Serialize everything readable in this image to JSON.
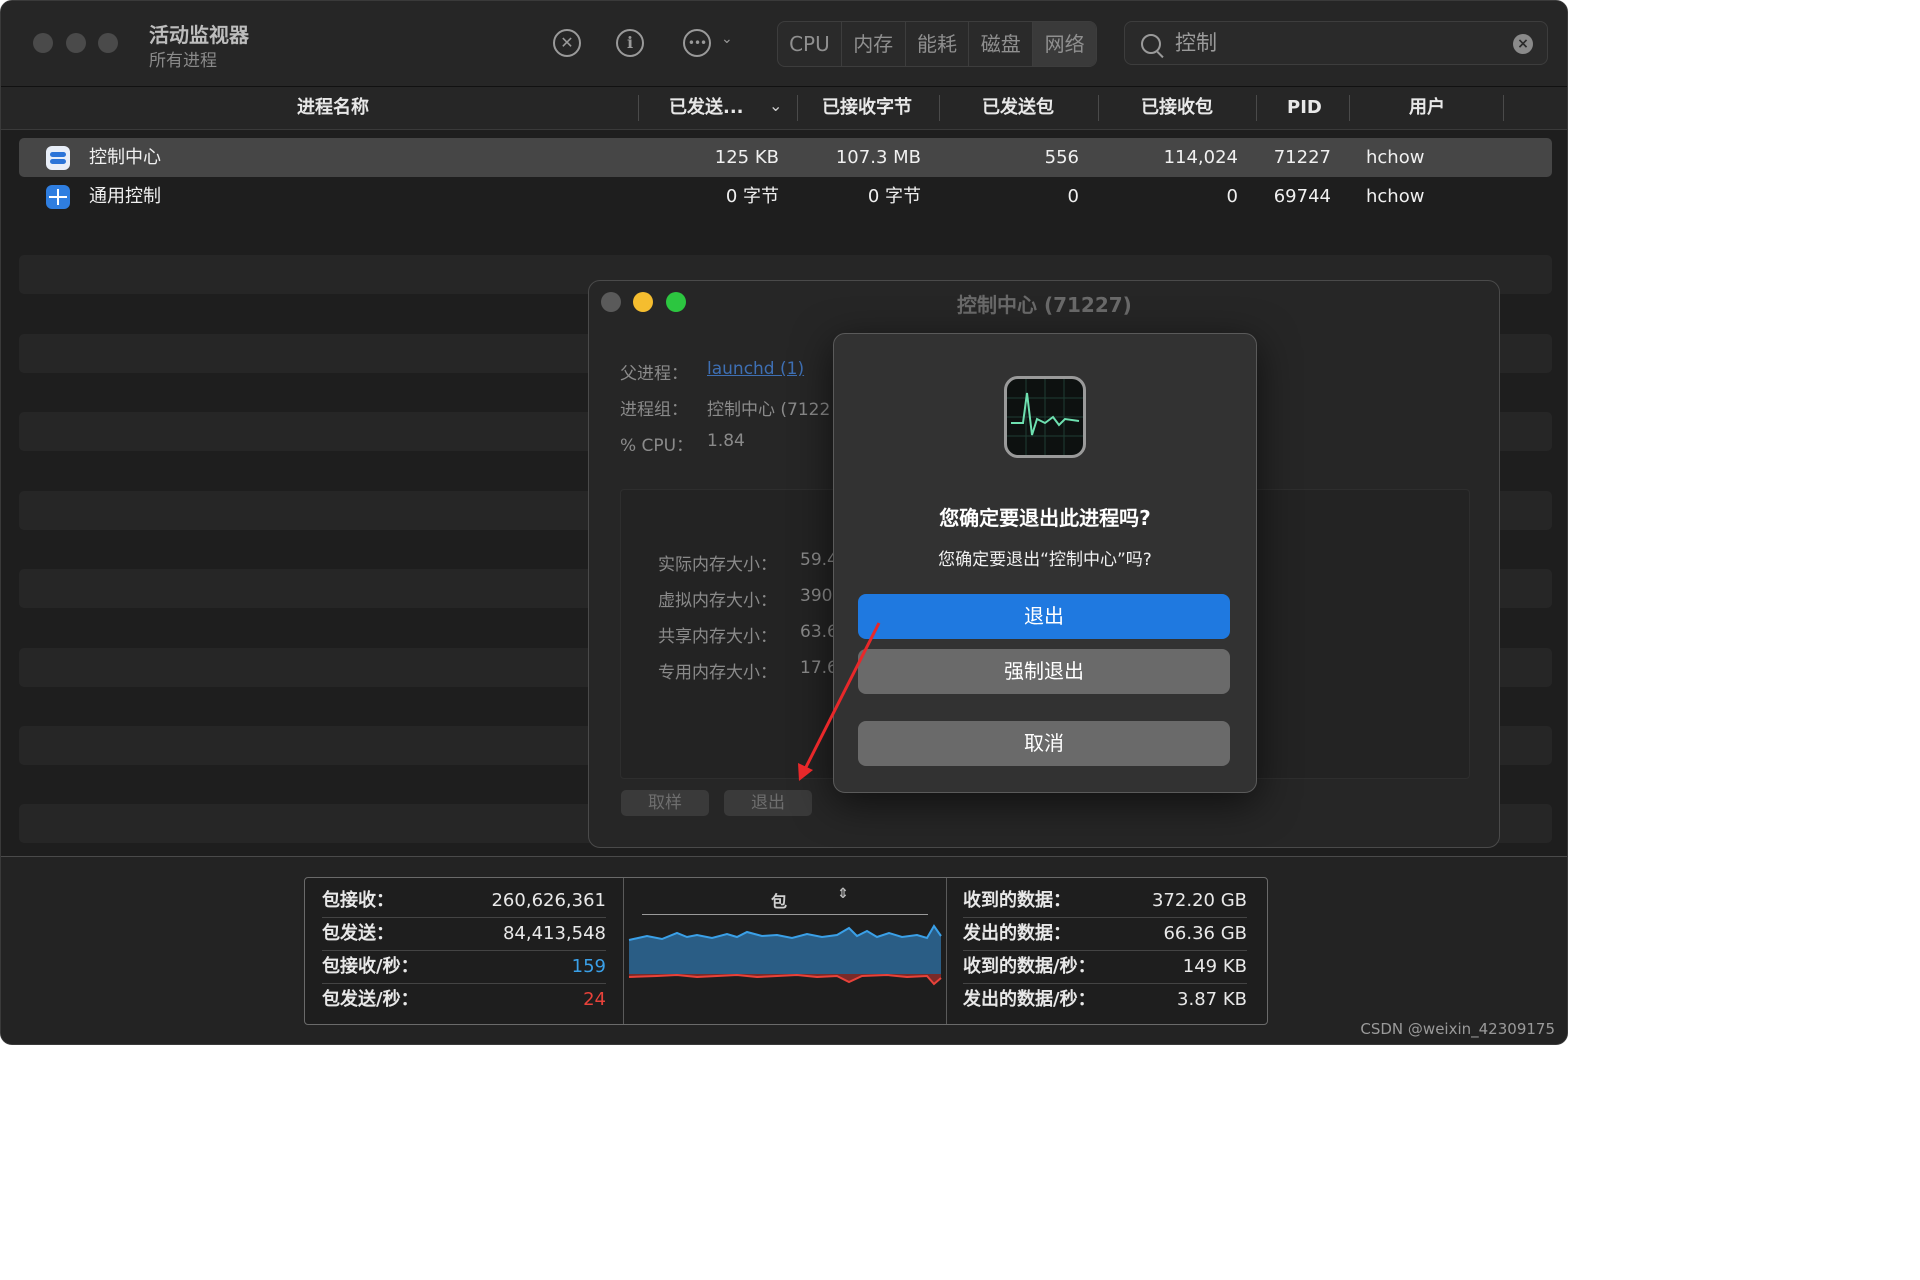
{
  "app": {
    "title": "活动监视器",
    "subtitle": "所有进程"
  },
  "toolbar": {
    "segments": [
      "CPU",
      "内存",
      "能耗",
      "磁盘",
      "网络"
    ],
    "active_segment": "网络",
    "search_value": "控制"
  },
  "columns": [
    "进程名称",
    "已发送...",
    "已接收字节",
    "已发送包",
    "已接收包",
    "PID",
    "用户"
  ],
  "processes": [
    {
      "name": "控制中心",
      "sent_bytes": "125 KB",
      "recv_bytes": "107.3 MB",
      "sent_packets": "556",
      "recv_packets": "114,024",
      "pid": "71227",
      "user": "hchow"
    },
    {
      "name": "通用控制",
      "sent_bytes": "0 字节",
      "recv_bytes": "0 字节",
      "sent_packets": "0",
      "recv_packets": "0",
      "pid": "69744",
      "user": "hchow"
    }
  ],
  "info_window": {
    "title": "控制中心 (71227)",
    "parent_label": "父进程：",
    "parent_value": "launchd (1)",
    "group_label": "进程组：",
    "group_value": "控制中心 (7122",
    "cpu_label": "% CPU：",
    "cpu_value": "1.84",
    "memory": [
      {
        "label": "实际内存大小：",
        "value": "59.4"
      },
      {
        "label": "虚拟内存大小：",
        "value": "390"
      },
      {
        "label": "共享内存大小：",
        "value": "63.6"
      },
      {
        "label": "专用内存大小：",
        "value": "17.6"
      }
    ],
    "sample_button": "取样",
    "quit_button": "退出"
  },
  "alert": {
    "title": "您确定要退出此进程吗?",
    "message": "您确定要退出“控制中心”吗?",
    "quit": "退出",
    "force_quit": "强制退出",
    "cancel": "取消"
  },
  "stats": {
    "left": [
      {
        "label": "包接收：",
        "value": "260,626,361"
      },
      {
        "label": "包发送：",
        "value": "84,413,548"
      },
      {
        "label": "包接收/秒：",
        "value": "159"
      },
      {
        "label": "包发送/秒：",
        "value": "24"
      }
    ],
    "chart_mode": "包",
    "right": [
      {
        "label": "收到的数据：",
        "value": "372.20 GB"
      },
      {
        "label": "发出的数据：",
        "value": "66.36 GB"
      },
      {
        "label": "收到的数据/秒：",
        "value": "149 KB"
      },
      {
        "label": "发出的数据/秒：",
        "value": "3.87 KB"
      }
    ]
  },
  "colors": {
    "recv": "#3aa0e8",
    "sent": "#e8423a",
    "primary_button": "#1f79e0"
  },
  "watermark": "CSDN @weixin_42309175"
}
